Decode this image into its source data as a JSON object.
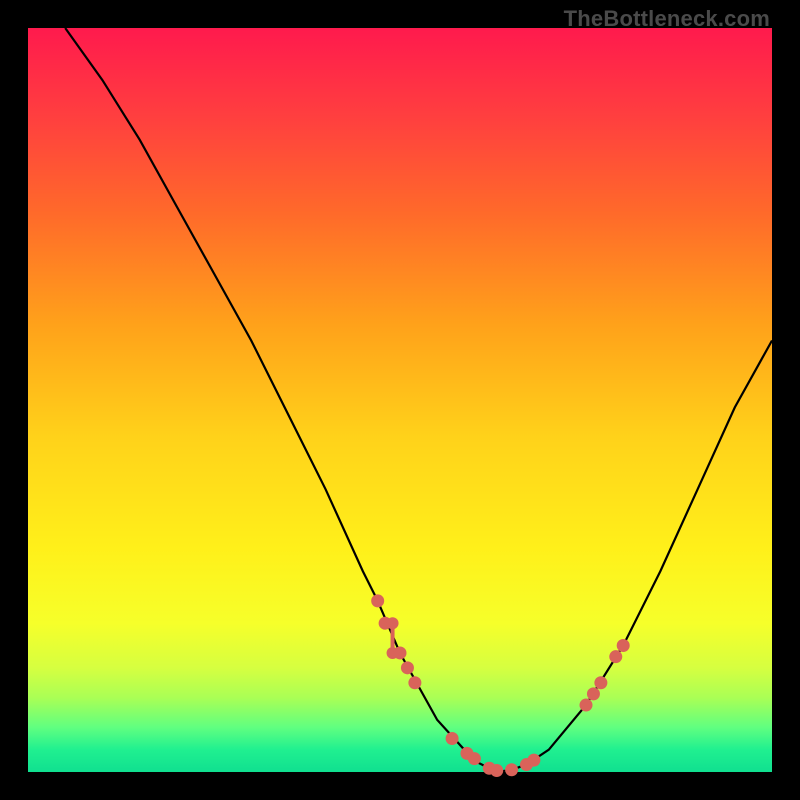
{
  "watermark": "TheBottleneck.com",
  "colors": {
    "background": "#000000",
    "curve": "#000000",
    "marker": "#d9635a",
    "gradient_top": "#ff1a4d",
    "gradient_bottom": "#10e090"
  },
  "chart_data": {
    "type": "line",
    "title": "",
    "xlabel": "",
    "ylabel": "",
    "xlim": [
      0,
      100
    ],
    "ylim": [
      0,
      100
    ],
    "curve": {
      "x": [
        5,
        10,
        15,
        20,
        25,
        30,
        35,
        40,
        45,
        47,
        50,
        55,
        60,
        63,
        65,
        67,
        70,
        75,
        80,
        85,
        90,
        95,
        100
      ],
      "y": [
        100,
        93,
        85,
        76,
        67,
        58,
        48,
        38,
        27,
        23,
        16,
        7,
        1.5,
        0,
        0.3,
        1,
        3,
        9,
        17,
        27,
        38,
        49,
        58
      ]
    },
    "markers": [
      {
        "x": 47,
        "y": 23
      },
      {
        "x": 48,
        "y": 20
      },
      {
        "x": 49,
        "y_top": 20,
        "y_bottom": 16,
        "type": "bar"
      },
      {
        "x": 50,
        "y": 16
      },
      {
        "x": 51,
        "y": 14
      },
      {
        "x": 52,
        "y": 12
      },
      {
        "x": 57,
        "y": 4.5
      },
      {
        "x": 59,
        "y": 2.5
      },
      {
        "x": 60,
        "y": 1.8
      },
      {
        "x": 62,
        "y": 0.5
      },
      {
        "x": 63,
        "y": 0.2
      },
      {
        "x": 65,
        "y": 0.3
      },
      {
        "x": 67,
        "y": 1.0
      },
      {
        "x": 68,
        "y": 1.6
      },
      {
        "x": 75,
        "y": 9
      },
      {
        "x": 76,
        "y": 10.5
      },
      {
        "x": 77,
        "y": 12
      },
      {
        "x": 79,
        "y": 15.5
      },
      {
        "x": 80,
        "y": 17
      }
    ]
  }
}
